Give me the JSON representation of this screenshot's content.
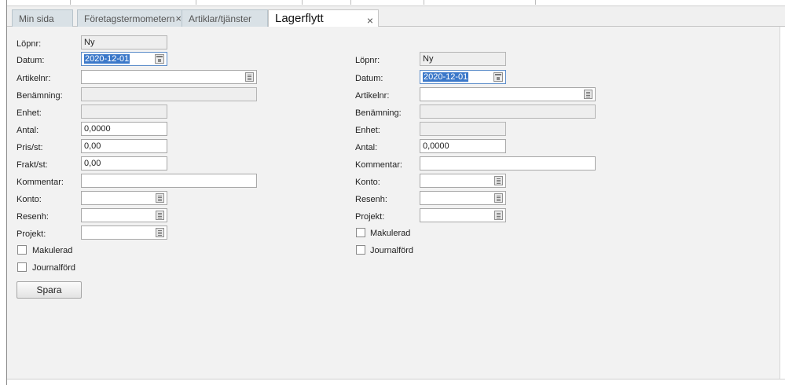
{
  "tabs": [
    {
      "label": "Min sida"
    },
    {
      "label": "Företagstermometern",
      "close": "×"
    },
    {
      "label": "Artiklar/tjänster"
    },
    {
      "label": "Lagerflytt",
      "close": "×"
    }
  ],
  "left_form": {
    "lopnr": {
      "label": "Löpnr:",
      "value": "Ny"
    },
    "datum": {
      "label": "Datum:",
      "value": "2020-12-01"
    },
    "artikelnr": {
      "label": "Artikelnr:",
      "value": ""
    },
    "benamning": {
      "label": "Benämning:",
      "value": ""
    },
    "enhet": {
      "label": "Enhet:",
      "value": ""
    },
    "antal": {
      "label": "Antal:",
      "value": "0,0000"
    },
    "pris": {
      "label": "Pris/st:",
      "value": "0,00"
    },
    "frakt": {
      "label": "Frakt/st:",
      "value": "0,00"
    },
    "kommentar": {
      "label": "Kommentar:",
      "value": ""
    },
    "konto": {
      "label": "Konto:",
      "value": ""
    },
    "resenh": {
      "label": "Resenh:",
      "value": ""
    },
    "projekt": {
      "label": "Projekt:",
      "value": ""
    },
    "makulerad": {
      "label": "Makulerad"
    },
    "journalford": {
      "label": "Journalförd"
    }
  },
  "right_form": {
    "lopnr": {
      "label": "Löpnr:",
      "value": "Ny"
    },
    "datum": {
      "label": "Datum:",
      "value": "2020-12-01"
    },
    "artikelnr": {
      "label": "Artikelnr:",
      "value": ""
    },
    "benamning": {
      "label": "Benämning:",
      "value": ""
    },
    "enhet": {
      "label": "Enhet:",
      "value": ""
    },
    "antal": {
      "label": "Antal:",
      "value": "0,0000"
    },
    "kommentar": {
      "label": "Kommentar:",
      "value": ""
    },
    "konto": {
      "label": "Konto:",
      "value": ""
    },
    "resenh": {
      "label": "Resenh:",
      "value": ""
    },
    "projekt": {
      "label": "Projekt:",
      "value": ""
    },
    "makulerad": {
      "label": "Makulerad"
    },
    "journalford": {
      "label": "Journalförd"
    }
  },
  "save_button": {
    "label": "Spara"
  },
  "colors": {
    "background": "#f2f2f2",
    "selection": "#3b78c9",
    "tab_inactive": "#d9e1e6"
  },
  "icons": [
    "close-icon",
    "calendar-icon",
    "lookup-icon",
    "checkbox"
  ]
}
